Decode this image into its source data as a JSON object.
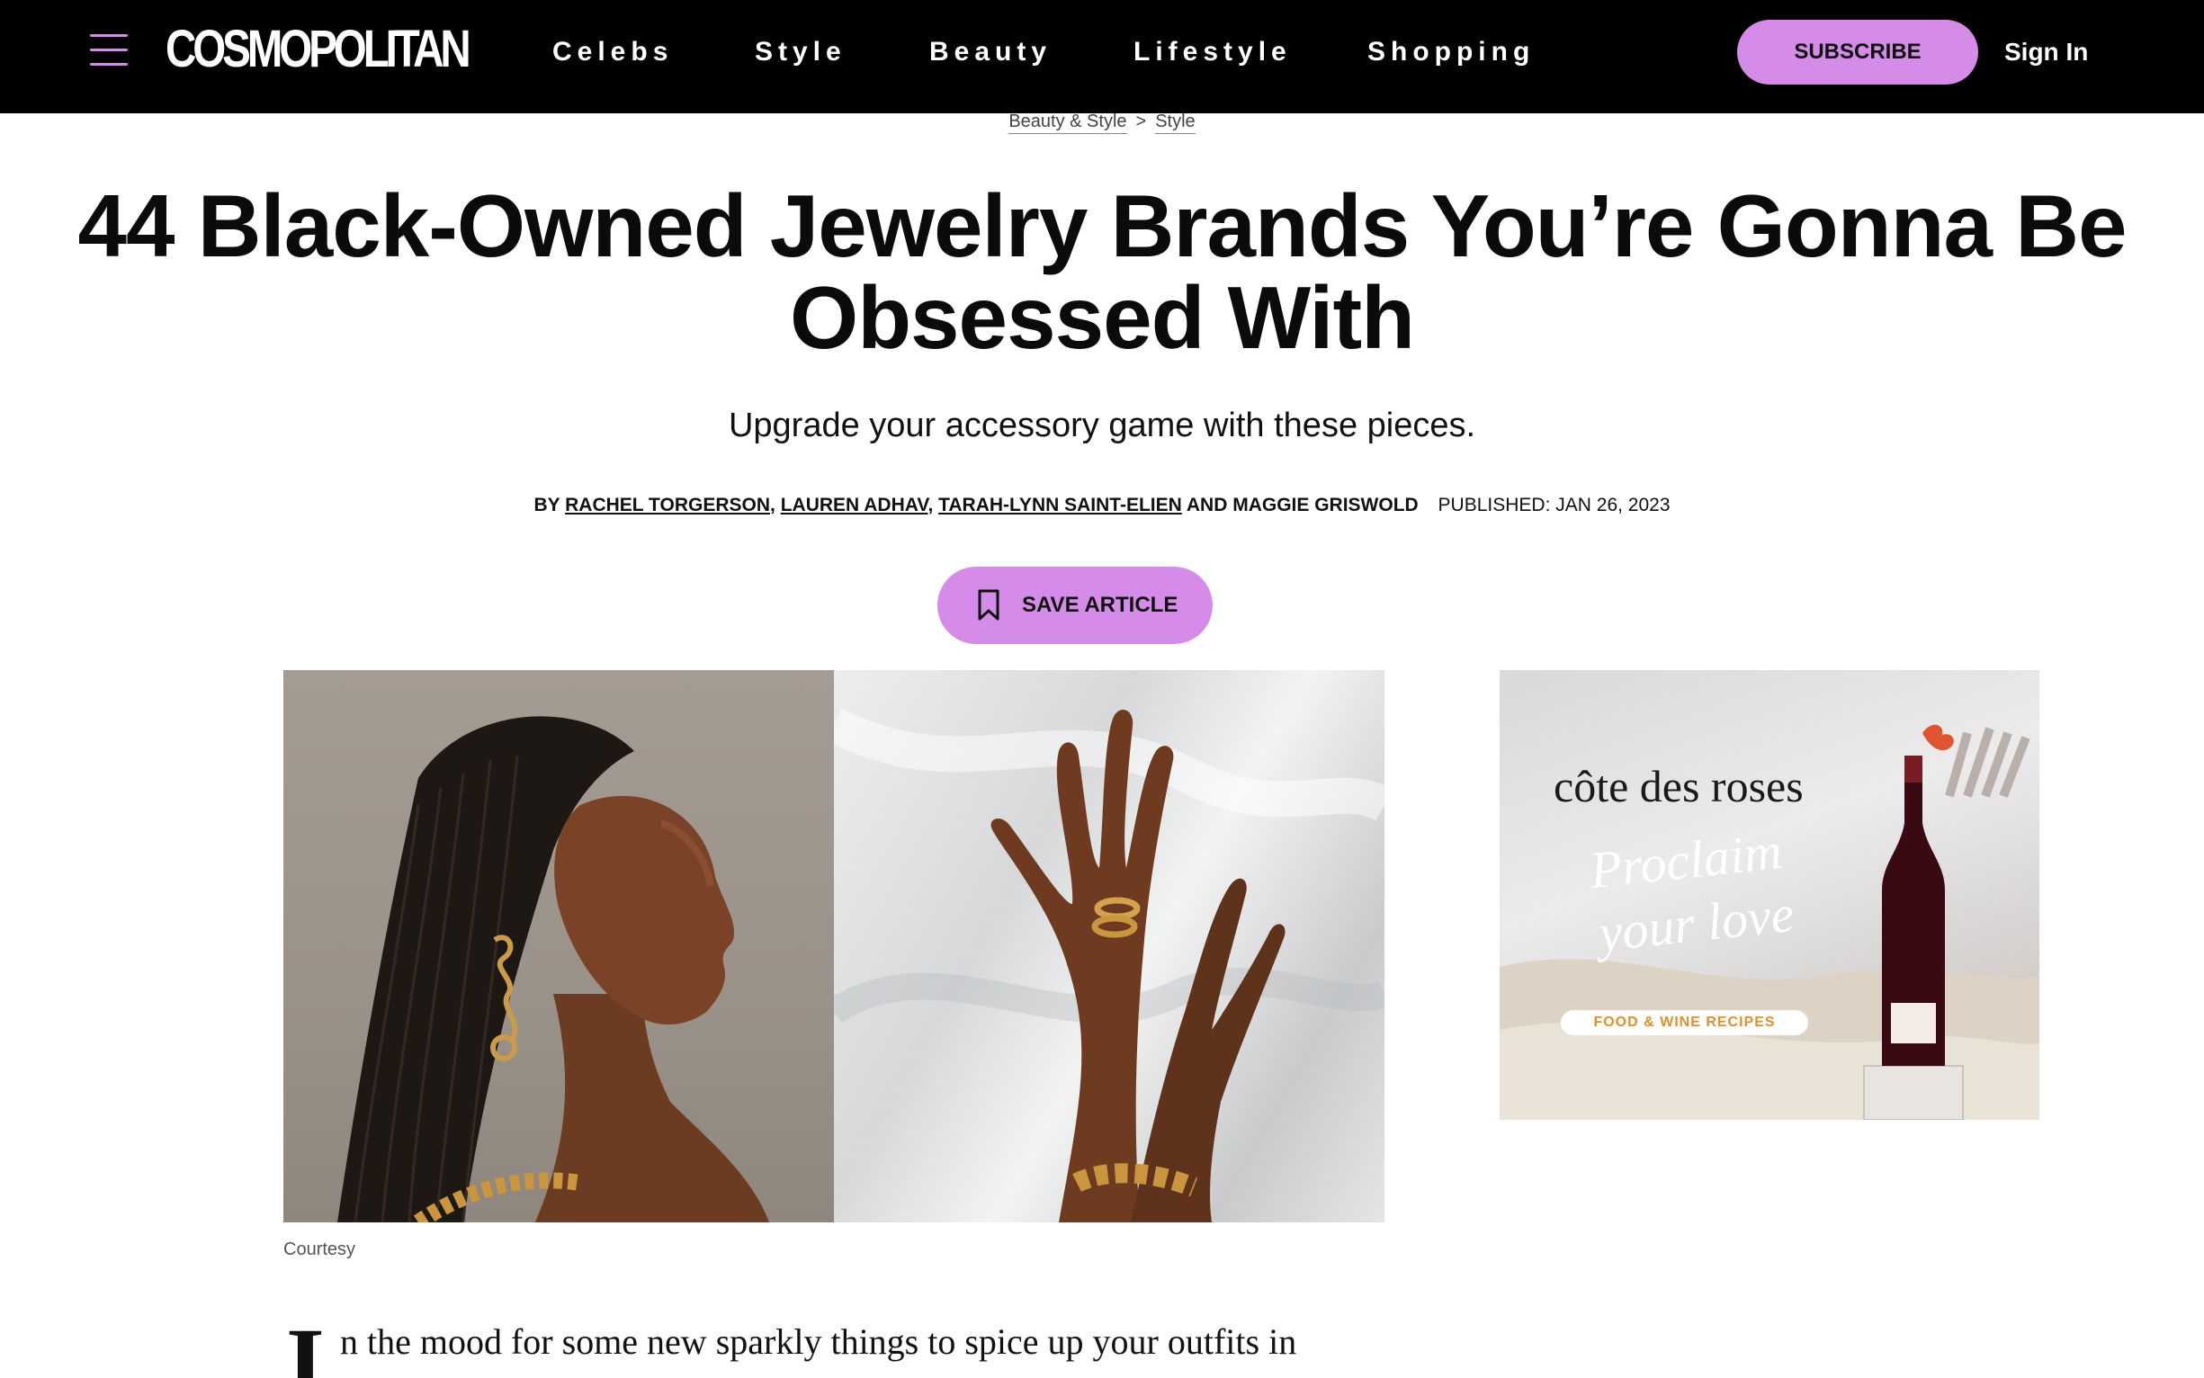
{
  "nav": {
    "logo": "COSMOPOLITAN",
    "links": [
      "Celebs",
      "Style",
      "Beauty",
      "Lifestyle",
      "Shopping"
    ],
    "subscribe": "SUBSCRIBE",
    "sign_in": "Sign In",
    "accent_color": "#d58ce8"
  },
  "breadcrumb": {
    "items": [
      "Beauty & Style",
      "Style"
    ],
    "separator": ">"
  },
  "article": {
    "title": "44 Black-Owned Jewelry Brands You’re Gonna Be Obsessed With",
    "dek": "Upgrade your accessory game with these pieces.",
    "byline": {
      "prefix": "BY",
      "authors": [
        "RACHEL TORGERSON",
        "LAUREN ADHAV",
        "TARAH-LYNN SAINT-ELIEN"
      ],
      "and": "AND",
      "last_author": "MAGGIE GRISWOLD",
      "published": "PUBLISHED: JAN 26, 2023"
    },
    "save_label": "SAVE ARTICLE",
    "hero_caption": "Courtesy",
    "dropcap": "I",
    "first_line": "n the mood for some new sparkly things to spice up your outfits in"
  },
  "ad": {
    "brand": "côte des roses",
    "headline_line1": "Proclaim",
    "headline_line2": "your love",
    "cta": "FOOD & WINE RECIPES"
  }
}
